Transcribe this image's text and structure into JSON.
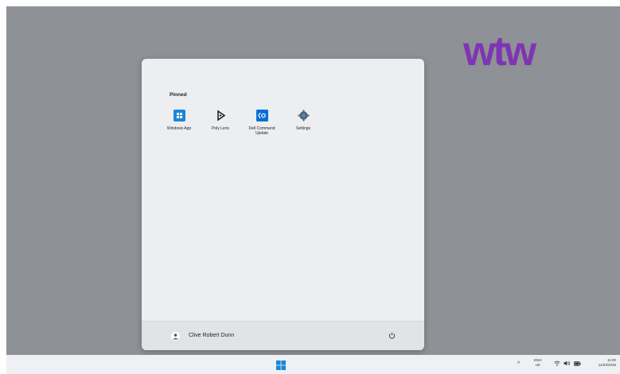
{
  "brand": {
    "logo_text": "wtw",
    "color": "#7f35b2"
  },
  "start_menu": {
    "pinned_title": "Pinned",
    "apps": [
      {
        "label": "Windows App",
        "icon": "windows-app-icon"
      },
      {
        "label": "Poly Lens",
        "icon": "poly-lens-icon"
      },
      {
        "label": "Dell Command Update",
        "icon": "dell-command-update-icon"
      },
      {
        "label": "Settings",
        "icon": "settings-gear-icon"
      }
    ],
    "user": {
      "name": "Clive Robert Dunn",
      "icon": "user-avatar-icon"
    },
    "power_icon": "power-icon"
  },
  "taskbar": {
    "start_icon": "windows-start-icon",
    "tray": {
      "chevron": "^",
      "lang_line1": "ENG",
      "lang_line2": "UK",
      "icons": [
        "wifi-icon",
        "volume-icon",
        "battery-icon"
      ],
      "time": "11:00",
      "date": "11/03/2025"
    }
  },
  "colors": {
    "desktop_bg": "#8e9195",
    "start_menu_bg": "#eceef1",
    "accent_blue": "#0a6fd4",
    "taskbar_bg": "#eef0f3"
  }
}
